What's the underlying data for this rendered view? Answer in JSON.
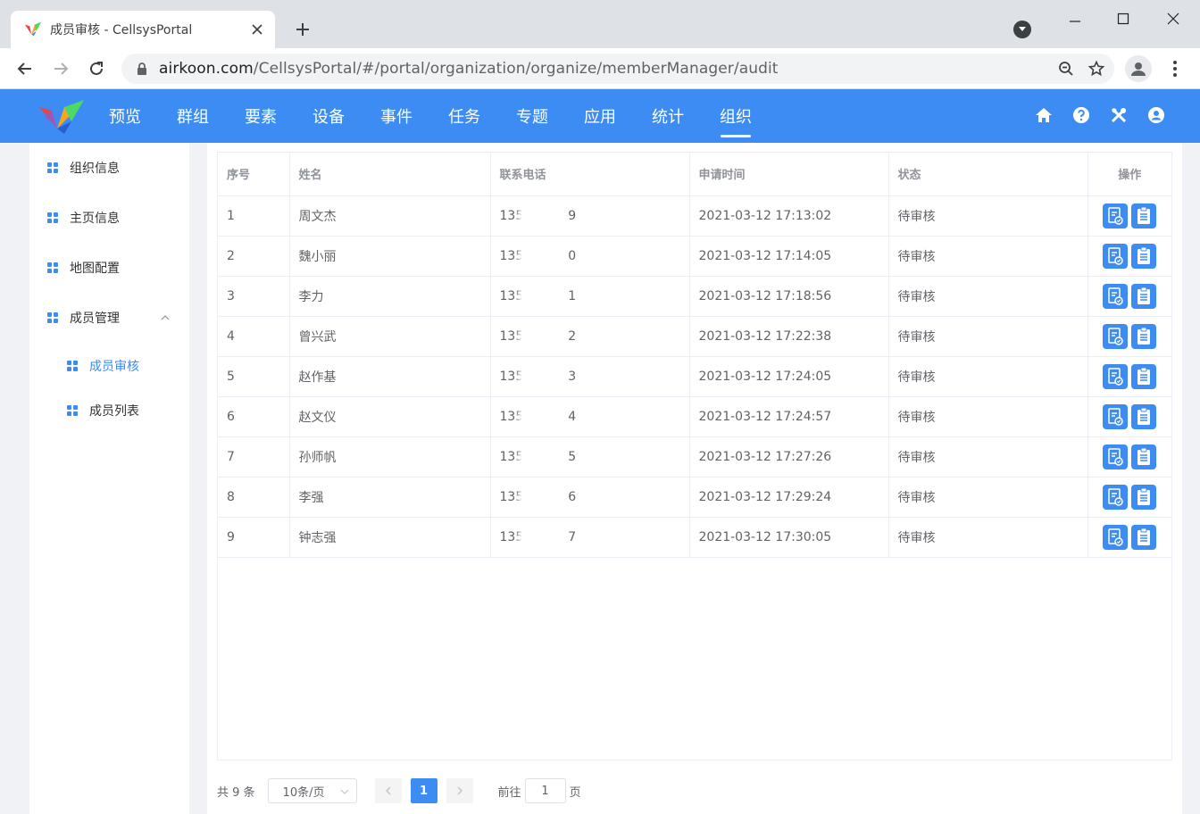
{
  "browser": {
    "tab_title": "成员审核 - CellsysPortal",
    "url_host": "airkoon.com",
    "url_path": "/CellsysPortal/#/portal/organization/organize/memberManager/audit"
  },
  "header": {
    "nav": [
      {
        "label": "预览"
      },
      {
        "label": "群组"
      },
      {
        "label": "要素"
      },
      {
        "label": "设备"
      },
      {
        "label": "事件"
      },
      {
        "label": "任务"
      },
      {
        "label": "专题"
      },
      {
        "label": "应用"
      },
      {
        "label": "统计"
      },
      {
        "label": "组织"
      }
    ],
    "active_nav": "组织",
    "icons": [
      "home-icon",
      "help-icon",
      "tools-icon",
      "user-icon"
    ]
  },
  "sidebar": {
    "items": [
      {
        "label": "组织信息"
      },
      {
        "label": "主页信息"
      },
      {
        "label": "地图配置"
      },
      {
        "label": "成员管理"
      },
      {
        "label": "成员审核"
      },
      {
        "label": "成员列表"
      }
    ]
  },
  "table": {
    "columns": [
      "序号",
      "姓名",
      "联系电话",
      "申请时间",
      "状态",
      "操作"
    ],
    "rows": [
      {
        "no": "1",
        "name": "周文杰",
        "phone_prefix": "135",
        "phone_suffix": "9",
        "time": "2021-03-12 17:13:02",
        "status": "待审核"
      },
      {
        "no": "2",
        "name": "魏小丽",
        "phone_prefix": "135",
        "phone_suffix": "0",
        "time": "2021-03-12 17:14:05",
        "status": "待审核"
      },
      {
        "no": "3",
        "name": "李力",
        "phone_prefix": "135",
        "phone_suffix": "1",
        "time": "2021-03-12 17:18:56",
        "status": "待审核"
      },
      {
        "no": "4",
        "name": "曾兴武",
        "phone_prefix": "135",
        "phone_suffix": "2",
        "time": "2021-03-12 17:22:38",
        "status": "待审核"
      },
      {
        "no": "5",
        "name": "赵作基",
        "phone_prefix": "135",
        "phone_suffix": "3",
        "time": "2021-03-12 17:24:05",
        "status": "待审核"
      },
      {
        "no": "6",
        "name": "赵文仪",
        "phone_prefix": "135",
        "phone_suffix": "4",
        "time": "2021-03-12 17:24:57",
        "status": "待审核"
      },
      {
        "no": "7",
        "name": "孙师帆",
        "phone_prefix": "135",
        "phone_suffix": "5",
        "time": "2021-03-12 17:27:26",
        "status": "待审核"
      },
      {
        "no": "8",
        "name": "李强",
        "phone_prefix": "135",
        "phone_suffix": "6",
        "time": "2021-03-12 17:29:24",
        "status": "待审核"
      },
      {
        "no": "9",
        "name": "钟志强",
        "phone_prefix": "135",
        "phone_suffix": "7",
        "time": "2021-03-12 17:30:05",
        "status": "待审核"
      }
    ]
  },
  "pagination": {
    "total": "共 9 条",
    "page_size": "10条/页",
    "current_page": "1",
    "goto_label": "前往",
    "goto_value": "1",
    "page_unit": "页"
  },
  "colors": {
    "brand": "#3c8cf4",
    "page_bg": "#f0f2f5"
  }
}
